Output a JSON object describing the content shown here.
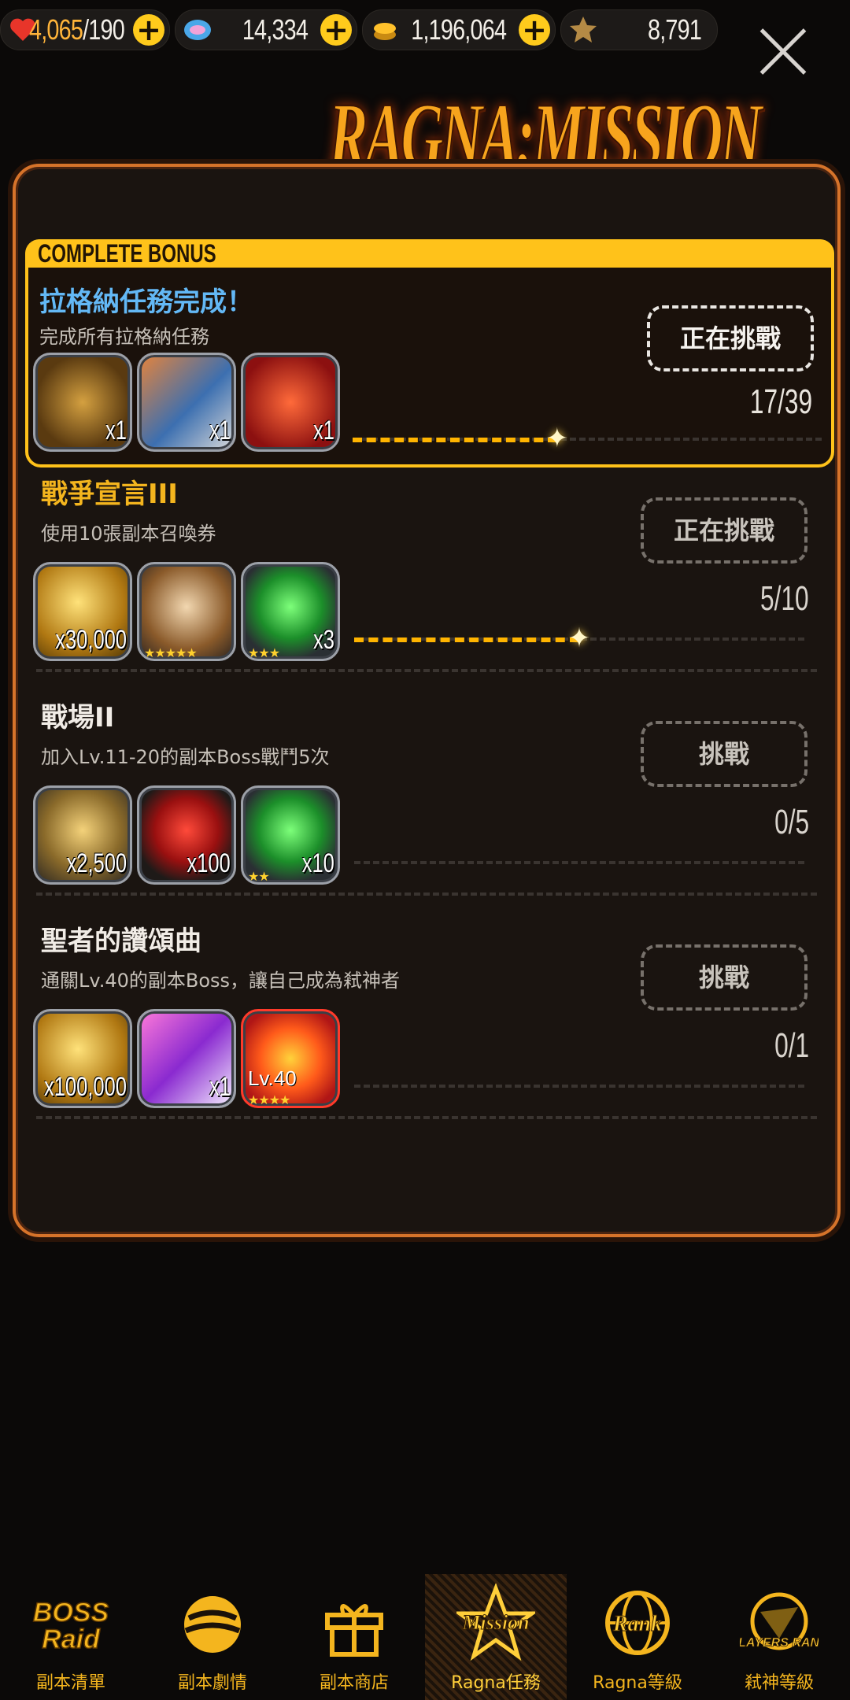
{
  "colors": {
    "accent": "#ffb400",
    "bonus_title": "#63b8f5",
    "panel_border": "#d6732a"
  },
  "currency": [
    {
      "name": "stamina",
      "icon": "heart-icon",
      "value_current": "4,065",
      "value_max": "/190"
    },
    {
      "name": "gems",
      "icon": "crystal-icon",
      "value": "14,334"
    },
    {
      "name": "coins",
      "icon": "coin-icon",
      "value": "1,196,064"
    },
    {
      "name": "slayer-points",
      "icon": "emblem-icon",
      "value": "8,791"
    }
  ],
  "title": "RAGNA:MISSION",
  "bonus": {
    "tab_label": "COMPLETE BONUS",
    "name": "拉格納任務完成！",
    "desc": "完成所有拉格納任務",
    "button": "正在挑戰",
    "progress": "17/39",
    "progress_ratio": 0.436,
    "rewards": [
      {
        "icon": "ticket-x10-icon",
        "qty": "x1"
      },
      {
        "icon": "race-card-icon",
        "qty": "x1"
      },
      {
        "icon": "red-card-icon",
        "qty": "x1"
      }
    ]
  },
  "missions": [
    {
      "name": "戰爭宣言III",
      "desc": "使用10張副本召喚券",
      "button": "正在挑戰",
      "progress": "5/10",
      "progress_ratio": 0.5,
      "rewards": [
        {
          "icon": "gold-coins-icon",
          "qty": "x30,000",
          "stars": ""
        },
        {
          "icon": "upgrade-orb-icon",
          "qty": "",
          "stars": "★★★★★"
        },
        {
          "icon": "green-gem-icon",
          "qty": "x3",
          "stars": "★★★"
        }
      ]
    },
    {
      "name": "戰場II",
      "desc": "加入Lv.11-20的副本Boss戰鬥5次",
      "button": "挑戰",
      "progress": "0/5",
      "progress_ratio": 0,
      "rewards": [
        {
          "icon": "medal-icon",
          "qty": "x2,500",
          "stars": ""
        },
        {
          "icon": "heart-item-icon",
          "qty": "x100",
          "stars": ""
        },
        {
          "icon": "green-gem-icon",
          "qty": "x10",
          "stars": "★★"
        }
      ]
    },
    {
      "name": "聖者的讚頌曲",
      "desc": "通關Lv.40的副本Boss，讓自己成為弒神者",
      "button": "挑戰",
      "progress": "0/1",
      "progress_ratio": 0,
      "rewards": [
        {
          "icon": "gold-coins-icon",
          "qty": "x100,000",
          "stars": ""
        },
        {
          "icon": "summon-ticket-icon",
          "qty": "x1",
          "stars": ""
        },
        {
          "icon": "fire-monster-icon",
          "qty": "",
          "stars": "★★★★",
          "level": "Lv.40"
        }
      ]
    }
  ],
  "nav": [
    {
      "icon": "boss-raid-icon",
      "label": "副本清單"
    },
    {
      "icon": "story-icon",
      "label": "副本劇情"
    },
    {
      "icon": "gift-icon",
      "label": "副本商店"
    },
    {
      "icon": "mission-icon",
      "label": "Ragna任務",
      "active": true
    },
    {
      "icon": "rank-icon",
      "label": "Ragna等級"
    },
    {
      "icon": "slayers-rank-icon",
      "label": "弒神等級"
    }
  ]
}
